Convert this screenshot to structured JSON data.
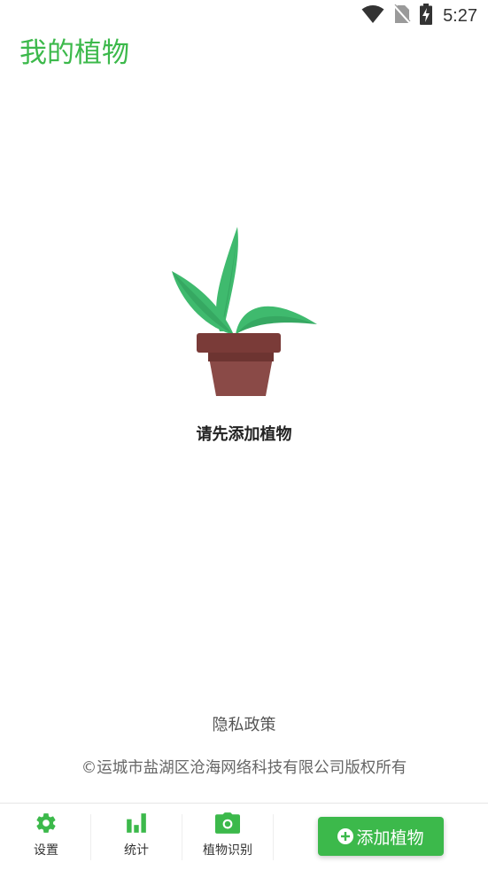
{
  "colors": {
    "brand_green": "#3cb94b",
    "leaf_green": "#3fba6e",
    "pot_brown": "#7a3b38",
    "text_dark": "#222222",
    "text_gray": "#666666"
  },
  "status_bar": {
    "time": "5:27",
    "icons": [
      "wifi-icon",
      "no-sim-icon",
      "battery-charging-icon"
    ]
  },
  "header": {
    "title": "我的植物"
  },
  "empty_state": {
    "illustration": "potted-plant-icon",
    "message": "请先添加植物"
  },
  "footer": {
    "privacy_label": "隐私政策",
    "copyright": "©运城市盐湖区沧海网络科技有限公司版权所有"
  },
  "bottom_nav": {
    "items": [
      {
        "label": "设置",
        "icon": "gear-icon"
      },
      {
        "label": "统计",
        "icon": "bar-chart-icon"
      },
      {
        "label": "植物识别",
        "icon": "camera-icon"
      }
    ],
    "add_button": {
      "label": "添加植物",
      "icon": "plus-circle-icon"
    }
  }
}
